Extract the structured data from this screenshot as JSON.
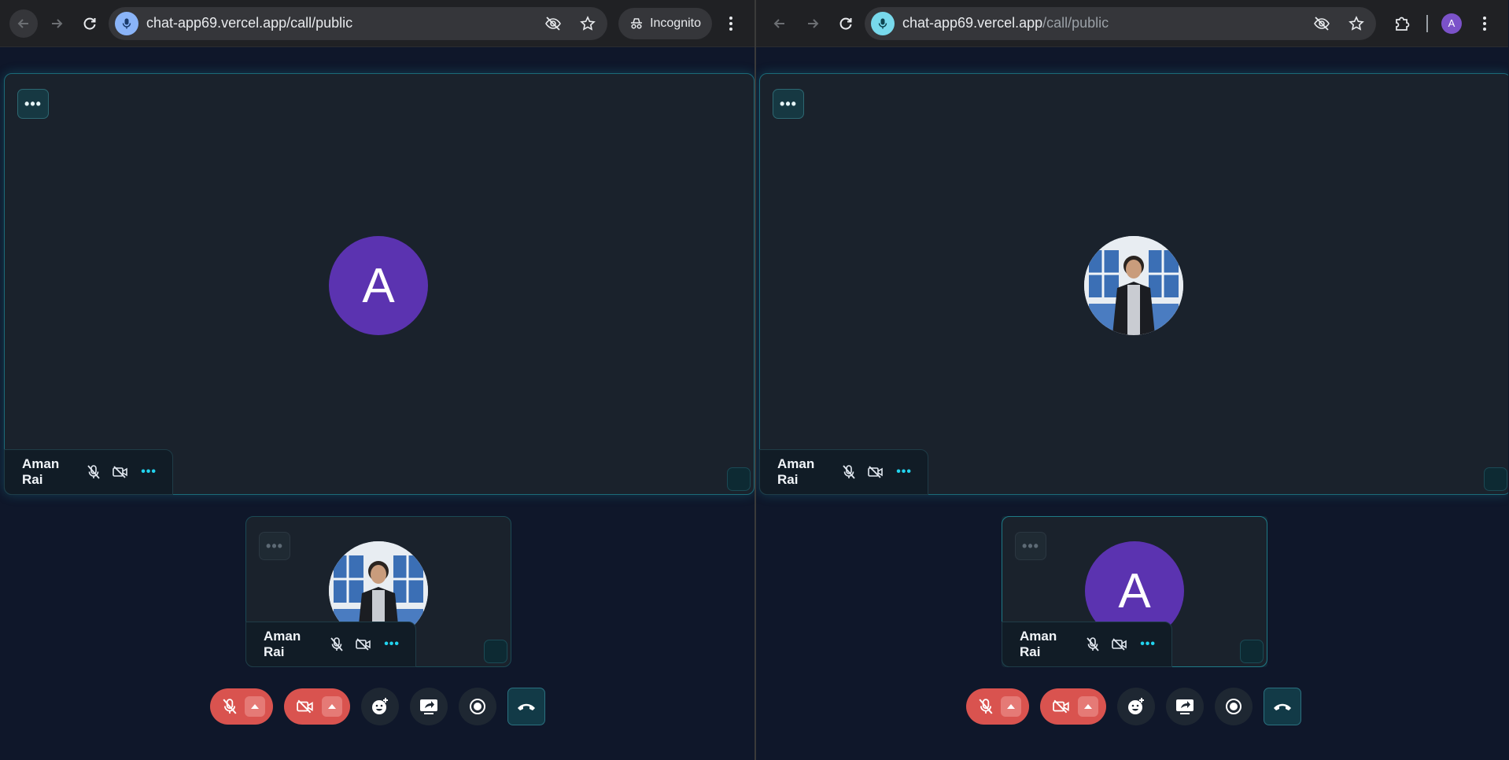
{
  "browser_left": {
    "url_host": "chat-app69.vercel.app",
    "url_path": "/call/public",
    "incognito_label": "Incognito"
  },
  "browser_right": {
    "url_host": "chat-app69.vercel.app",
    "url_path": "/call/public",
    "profile_initial": "A"
  },
  "left_call": {
    "main_tile": {
      "avatar_letter": "A",
      "name": "Aman Rai",
      "more": "•••",
      "menu": "•••"
    },
    "small_tile": {
      "name": "Aman Rai",
      "more": "•••",
      "menu": "•••"
    }
  },
  "right_call": {
    "main_tile": {
      "name": "Aman Rai",
      "more": "•••",
      "menu": "•••"
    },
    "small_tile": {
      "avatar_letter": "A",
      "name": "Aman Rai",
      "more": "•••",
      "menu": "•••"
    }
  },
  "colors": {
    "background": "#0f172a",
    "tile": "#1a222c",
    "accent": "#22d3ee",
    "avatar": "#5b33b0",
    "danger": "#d9534f"
  }
}
